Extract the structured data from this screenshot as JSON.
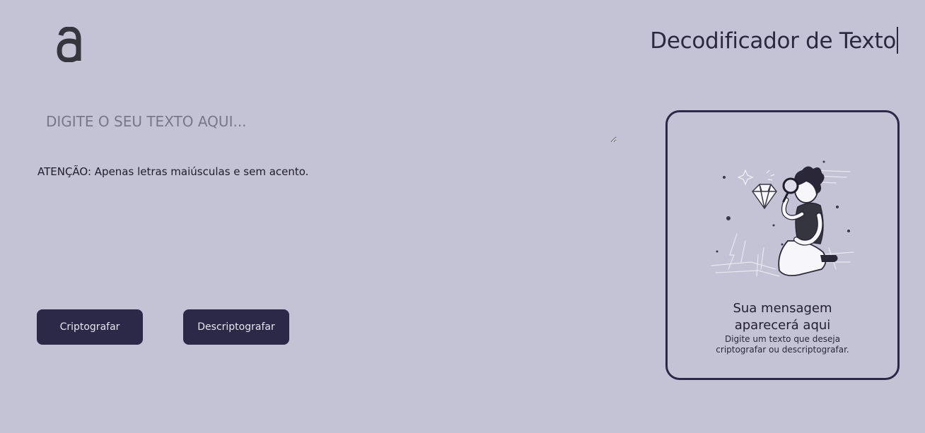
{
  "header": {
    "logo_icon": "alura-a-logo-icon",
    "title": "Decodificador de Texto"
  },
  "input": {
    "placeholder": "DIGITE O SEU TEXTO AQUI...",
    "value": ""
  },
  "warning": "ATENÇÃO: Apenas letras maiúsculas e sem acento.",
  "buttons": {
    "encrypt_label": "Criptografar",
    "decrypt_label": "Descriptografar"
  },
  "output": {
    "illustration_icon": "person-with-magnifying-glass-illustration",
    "title": "Sua mensagem aparecerá aqui",
    "subtitle": "Digite um texto que deseja criptografar ou descriptografar."
  },
  "colors": {
    "background": "#c4c2d5",
    "button": "#2b2848",
    "button_text": "#e7e5f2",
    "text": "#232030",
    "placeholder": "#787688"
  }
}
